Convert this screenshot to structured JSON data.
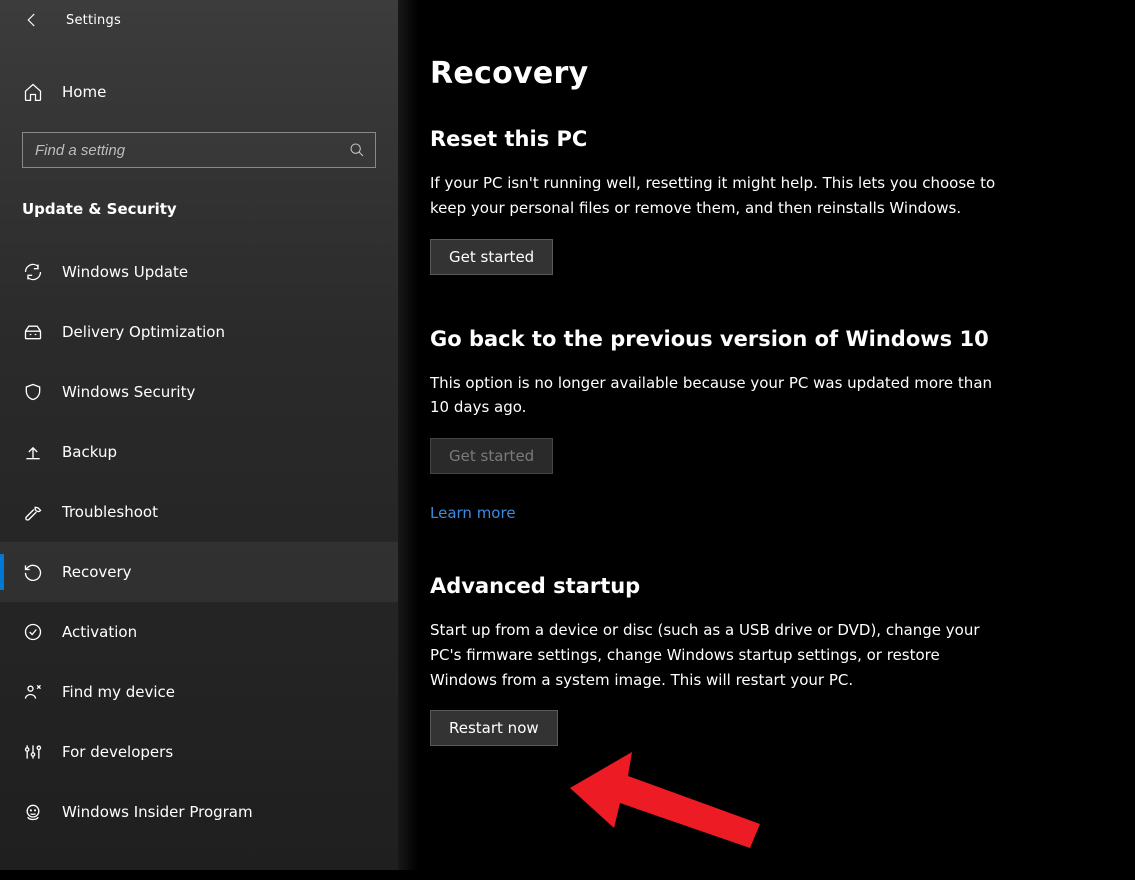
{
  "window": {
    "title": "Settings"
  },
  "sidebar": {
    "home_label": "Home",
    "search_placeholder": "Find a setting",
    "category_label": "Update & Security",
    "items": [
      {
        "label": "Windows Update"
      },
      {
        "label": "Delivery Optimization"
      },
      {
        "label": "Windows Security"
      },
      {
        "label": "Backup"
      },
      {
        "label": "Troubleshoot"
      },
      {
        "label": "Recovery"
      },
      {
        "label": "Activation"
      },
      {
        "label": "Find my device"
      },
      {
        "label": "For developers"
      },
      {
        "label": "Windows Insider Program"
      }
    ]
  },
  "main": {
    "title": "Recovery",
    "reset": {
      "heading": "Reset this PC",
      "desc": "If your PC isn't running well, resetting it might help. This lets you choose to keep your personal files or remove them, and then reinstalls Windows.",
      "button": "Get started"
    },
    "goback": {
      "heading": "Go back to the previous version of Windows 10",
      "desc": "This option is no longer available because your PC was updated more than 10 days ago.",
      "button": "Get started",
      "link": "Learn more"
    },
    "advanced": {
      "heading": "Advanced startup",
      "desc": "Start up from a device or disc (such as a USB drive or DVD), change your PC's firmware settings, change Windows startup settings, or restore Windows from a system image. This will restart your PC.",
      "button": "Restart now"
    }
  },
  "annotation": {
    "arrow_target": "restart-now-button",
    "arrow_color": "#ed1c24"
  }
}
